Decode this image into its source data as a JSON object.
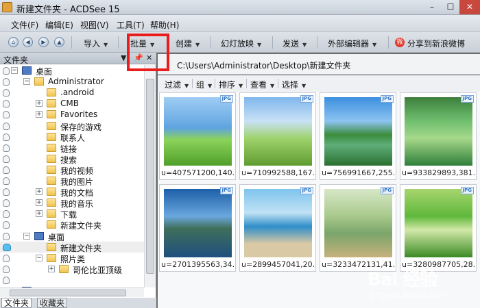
{
  "window": {
    "title": "新建文件夹 - ACDSee 15",
    "min": "–",
    "max": "☐",
    "close": "✕"
  },
  "menu": [
    "文件(F)",
    "编辑(E)",
    "视图(V)",
    "工具(T)",
    "帮助(H)"
  ],
  "toolbar": {
    "items": [
      "导入",
      "批量",
      "创建",
      "幻灯放映",
      "发送",
      "外部编辑器",
      "分享到新浪微博"
    ],
    "weibo_icon": "weibo-icon"
  },
  "folder_panel": {
    "title": "文件夹",
    "pin": "📌",
    "close": "✕",
    "tabs": [
      "文件夹",
      "收藏夹"
    ],
    "tree": [
      {
        "label": "桌面",
        "icon": "desktop",
        "expander": "−"
      },
      {
        "label": "Administrator",
        "icon": "user",
        "expander": "−"
      },
      {
        "label": ".android",
        "icon": "folder",
        "expander": ""
      },
      {
        "label": "CMB",
        "icon": "folder",
        "expander": "+"
      },
      {
        "label": "Favorites",
        "icon": "folder",
        "expander": "+"
      },
      {
        "label": "保存的游戏",
        "icon": "folder",
        "expander": ""
      },
      {
        "label": "联系人",
        "icon": "folder",
        "expander": ""
      },
      {
        "label": "链接",
        "icon": "folder",
        "expander": ""
      },
      {
        "label": "搜索",
        "icon": "folder",
        "expander": ""
      },
      {
        "label": "我的视频",
        "icon": "folder",
        "expander": ""
      },
      {
        "label": "我的图片",
        "icon": "folder",
        "expander": ""
      },
      {
        "label": "我的文档",
        "icon": "folder",
        "expander": "+"
      },
      {
        "label": "我的音乐",
        "icon": "folder",
        "expander": "+"
      },
      {
        "label": "下载",
        "icon": "folder",
        "expander": "+"
      },
      {
        "label": "新建文件夹",
        "icon": "folder",
        "expander": ""
      },
      {
        "label": "桌面",
        "icon": "desktop",
        "expander": "−"
      },
      {
        "label": "新建文件夹",
        "icon": "folder",
        "expander": ""
      },
      {
        "label": "照片类",
        "icon": "folder",
        "expander": "−"
      },
      {
        "label": "哥伦比亚顶级",
        "icon": "folder",
        "expander": "+"
      },
      {
        "label": "",
        "icon": "",
        "expander": ""
      },
      {
        "label": "计算机",
        "icon": "computer",
        "expander": "+"
      }
    ]
  },
  "path_bar": {
    "path": "C:\\Users\\Administrator\\Desktop\\新建文件夹"
  },
  "filter_bar": [
    "过滤",
    "组",
    "排序",
    "查看",
    "选择"
  ],
  "thumbnails": [
    {
      "caption": "u=407571200,140...",
      "badge": "JPG"
    },
    {
      "caption": "u=710992588,167...",
      "badge": "JPG"
    },
    {
      "caption": "u=756991667,255...",
      "badge": "JPG"
    },
    {
      "caption": "u=933829893,381...",
      "badge": "JPG"
    },
    {
      "caption": "u=2701395563,34...",
      "badge": "JPG"
    },
    {
      "caption": "u=2899457041,20...",
      "badge": "JPG"
    },
    {
      "caption": "u=3233472131,41...",
      "badge": "JPG"
    },
    {
      "caption": "u=3280987705,28...",
      "badge": "JPG"
    }
  ],
  "watermark": {
    "brand": "Bai 经验",
    "site": "jingyan.baidu.com"
  }
}
